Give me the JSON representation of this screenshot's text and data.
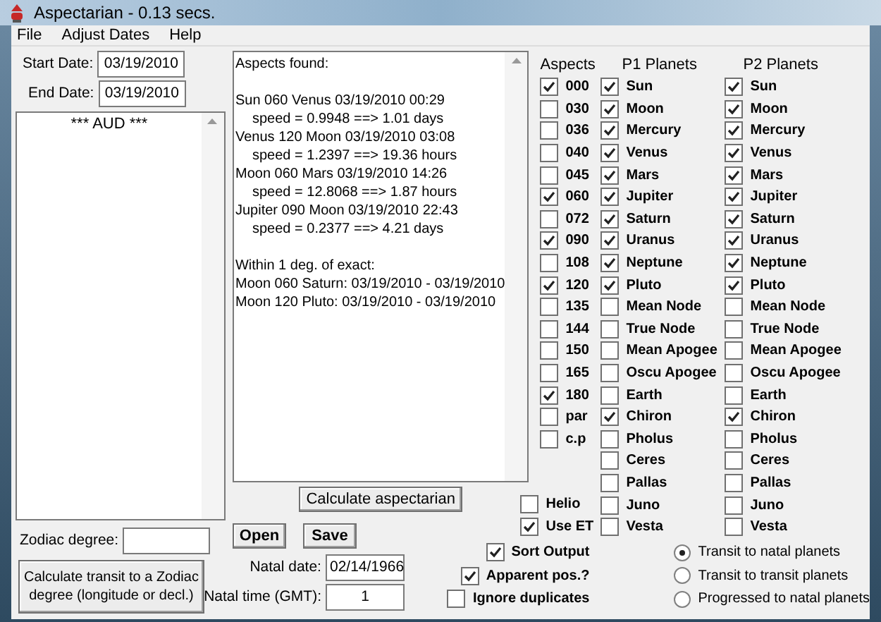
{
  "window": {
    "title": "Aspectarian - 0.13 secs."
  },
  "menu": [
    {
      "label": "File"
    },
    {
      "label": "Adjust Dates"
    },
    {
      "label": "Help"
    }
  ],
  "start_date": {
    "label": "Start Date:",
    "value": "03/19/2010"
  },
  "end_date": {
    "label": "End Date:",
    "value": "03/19/2010"
  },
  "list_box": {
    "items": [
      "*** AUD ***"
    ]
  },
  "zodiac_degree": {
    "label": "Zodiac degree:"
  },
  "zodiac_button": {
    "label": "Calculate transit to a Zodiac degree (longitude or decl.)"
  },
  "output": {
    "heading": "Aspects found:",
    "aspects": [
      {
        "line": "Sun 060 Venus 03/19/2010 00:29",
        "speed": "speed = 0.9948 ==> 1.01 days"
      },
      {
        "line": "Venus 120 Moon 03/19/2010 03:08",
        "speed": "speed = 1.2397 ==> 19.36 hours"
      },
      {
        "line": "Moon 060 Mars 03/19/2010 14:26",
        "speed": "speed = 12.8068 ==> 1.87 hours"
      },
      {
        "line": "Jupiter 090 Moon 03/19/2010 22:43",
        "speed": "speed = 0.2377 ==> 4.21 days"
      }
    ],
    "exact_heading": "Within 1 deg. of exact:",
    "exact": [
      "Moon 060 Saturn: 03/19/2010 - 03/19/2010",
      "Moon 120 Pluto: 03/19/2010 - 03/19/2010"
    ]
  },
  "calc_button": {
    "label": "Calculate aspectarian"
  },
  "open_button": {
    "label": "Open"
  },
  "save_button": {
    "label": "Save"
  },
  "natal_date": {
    "label": "Natal date:",
    "value": "02/14/1966"
  },
  "natal_time": {
    "label": "Natal time (GMT):",
    "value": "1"
  },
  "headers": {
    "aspects": "Aspects",
    "p1": "P1 Planets",
    "p2": "P2 Planets"
  },
  "aspects": [
    {
      "label": "000",
      "checked": true
    },
    {
      "label": "030",
      "checked": false
    },
    {
      "label": "036",
      "checked": false
    },
    {
      "label": "040",
      "checked": false
    },
    {
      "label": "045",
      "checked": false
    },
    {
      "label": "060",
      "checked": true
    },
    {
      "label": "072",
      "checked": false
    },
    {
      "label": "090",
      "checked": true
    },
    {
      "label": "108",
      "checked": false
    },
    {
      "label": "120",
      "checked": true
    },
    {
      "label": "135",
      "checked": false
    },
    {
      "label": "144",
      "checked": false
    },
    {
      "label": "150",
      "checked": false
    },
    {
      "label": "165",
      "checked": false
    },
    {
      "label": "180",
      "checked": true
    },
    {
      "label": "par",
      "checked": false
    },
    {
      "label": "c.p",
      "checked": false
    }
  ],
  "p1_planets": [
    {
      "label": "Sun",
      "checked": true
    },
    {
      "label": "Moon",
      "checked": true
    },
    {
      "label": "Mercury",
      "checked": true
    },
    {
      "label": "Venus",
      "checked": true
    },
    {
      "label": "Mars",
      "checked": true
    },
    {
      "label": "Jupiter",
      "checked": true
    },
    {
      "label": "Saturn",
      "checked": true
    },
    {
      "label": "Uranus",
      "checked": true
    },
    {
      "label": "Neptune",
      "checked": true
    },
    {
      "label": "Pluto",
      "checked": true
    },
    {
      "label": "Mean Node",
      "checked": false
    },
    {
      "label": "True Node",
      "checked": false
    },
    {
      "label": "Mean Apogee",
      "checked": false
    },
    {
      "label": "Oscu Apogee",
      "checked": false
    },
    {
      "label": "Earth",
      "checked": false
    },
    {
      "label": "Chiron",
      "checked": true
    },
    {
      "label": "Pholus",
      "checked": false
    },
    {
      "label": "Ceres",
      "checked": false
    },
    {
      "label": "Pallas",
      "checked": false
    },
    {
      "label": "Juno",
      "checked": false
    },
    {
      "label": "Vesta",
      "checked": false
    }
  ],
  "p2_planets": [
    {
      "label": "Sun",
      "checked": true
    },
    {
      "label": "Moon",
      "checked": true
    },
    {
      "label": "Mercury",
      "checked": true
    },
    {
      "label": "Venus",
      "checked": true
    },
    {
      "label": "Mars",
      "checked": true
    },
    {
      "label": "Jupiter",
      "checked": true
    },
    {
      "label": "Saturn",
      "checked": true
    },
    {
      "label": "Uranus",
      "checked": true
    },
    {
      "label": "Neptune",
      "checked": true
    },
    {
      "label": "Pluto",
      "checked": true
    },
    {
      "label": "Mean Node",
      "checked": false
    },
    {
      "label": "True Node",
      "checked": false
    },
    {
      "label": "Mean Apogee",
      "checked": false
    },
    {
      "label": "Oscu Apogee",
      "checked": false
    },
    {
      "label": "Earth",
      "checked": false
    },
    {
      "label": "Chiron",
      "checked": true
    },
    {
      "label": "Pholus",
      "checked": false
    },
    {
      "label": "Ceres",
      "checked": false
    },
    {
      "label": "Pallas",
      "checked": false
    },
    {
      "label": "Juno",
      "checked": false
    },
    {
      "label": "Vesta",
      "checked": false
    }
  ],
  "extra_options": [
    {
      "label": "Helio",
      "checked": false
    },
    {
      "label": "Use ET",
      "checked": true
    }
  ],
  "options": [
    {
      "label": "Sort Output",
      "checked": true
    },
    {
      "label": "Apparent pos.?",
      "checked": true
    },
    {
      "label": "Ignore duplicates",
      "checked": false
    }
  ],
  "modes": [
    {
      "label": "Transit to natal planets",
      "selected": true
    },
    {
      "label": "Transit to transit planets",
      "selected": false
    },
    {
      "label": "Progressed to natal planets",
      "selected": false
    }
  ]
}
